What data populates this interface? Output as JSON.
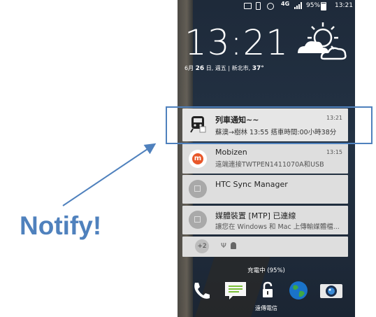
{
  "status_bar": {
    "network": "4G",
    "battery_pct": "95%",
    "time": "13:21"
  },
  "lockscreen": {
    "clock": "13:21",
    "date_prefix": "6月",
    "date_day": "26",
    "date_suffix": "日, 週五 | 新北市,",
    "temperature": "37°"
  },
  "notifications": [
    {
      "title": "列車通知~~",
      "time": "13:21",
      "body": "蘇澳→樹林 13:55  搭車時間:00小時38分",
      "icon": "train-icon"
    },
    {
      "title": "Mobizen",
      "time": "13:15",
      "body": "遠端連接TWTPEN1411070A和USB",
      "icon": "mobizen-icon"
    },
    {
      "title": "HTC Sync Manager",
      "time": "",
      "body": "",
      "icon": "sync-icon"
    },
    {
      "title": "媒體裝置 [MTP] 已連線",
      "time": "",
      "body": "讓您在 Windows 和 Mac 上傳輸媒體檔...",
      "icon": "usb-icon"
    },
    {
      "overflow_count": "+2",
      "icon": "more-icons"
    }
  ],
  "charging": "充電中 (95%)",
  "carrier": "遠傳電信",
  "dock": {
    "apps": [
      "phone-icon",
      "messages-icon",
      "unlock-icon",
      "browser-icon",
      "camera-icon"
    ]
  },
  "annotation": {
    "callout": "Notify!",
    "accent_color": "#4f81bd"
  }
}
